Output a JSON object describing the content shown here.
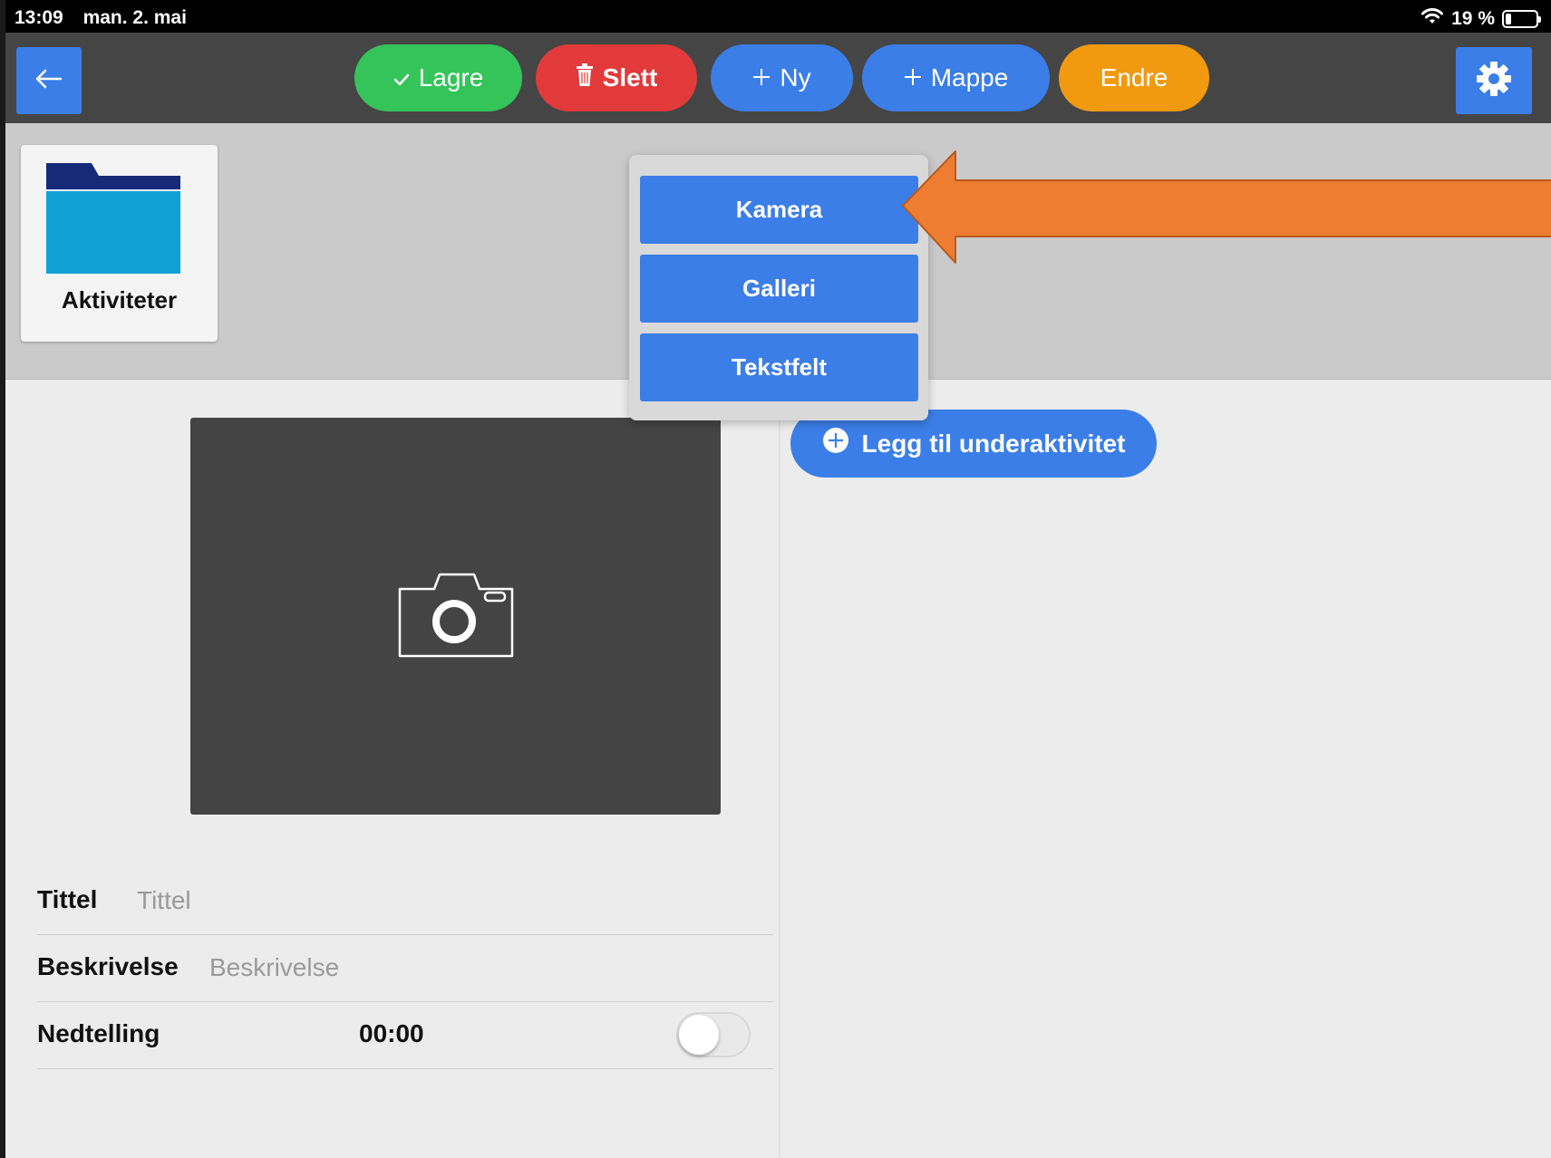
{
  "status_bar": {
    "time": "13:09",
    "date": "man. 2. mai",
    "battery": "19 %",
    "battery_level": 0.19
  },
  "toolbar": {
    "save_label": "Lagre",
    "delete_label": "Slett",
    "new_label": "Ny",
    "folder_label": "Mappe",
    "edit_label": "Endre"
  },
  "folder": {
    "label": "Aktiviteter"
  },
  "popup": {
    "items": [
      "Kamera",
      "Galleri",
      "Tekstfelt"
    ]
  },
  "main": {
    "add_subactivity_label": "Legg til underaktivitet"
  },
  "form": {
    "title_label": "Tittel",
    "title_placeholder": "Tittel",
    "description_label": "Beskrivelse",
    "description_placeholder": "Beskrivelse",
    "countdown_label": "Nedtelling",
    "countdown_value": "00:00",
    "countdown_enabled": false
  },
  "colors": {
    "primary_blue": "#3b7ee8",
    "save_green": "#35c45a",
    "delete_red": "#e23a3a",
    "edit_orange": "#f19a10",
    "toolbar_bg": "#454545",
    "annotation_arrow": "#ef7d31"
  }
}
